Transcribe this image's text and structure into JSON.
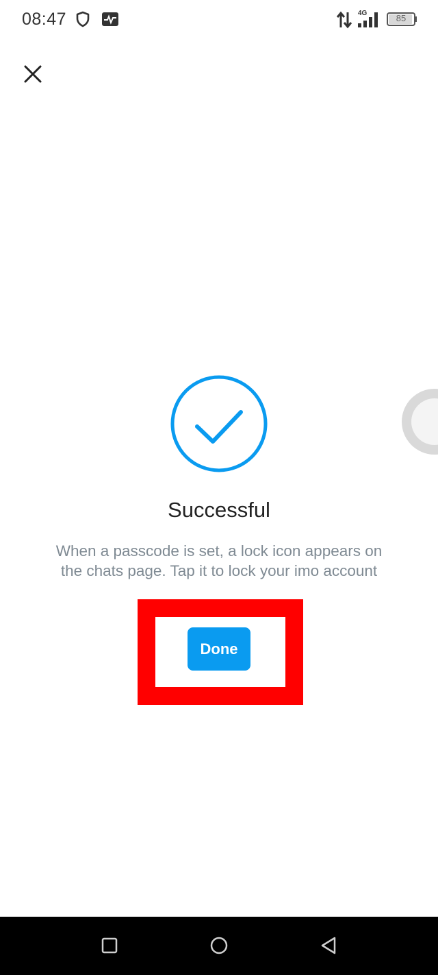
{
  "status_bar": {
    "time": "08:47",
    "battery_level": "85",
    "network_type": "4G",
    "icons": [
      "shield-icon",
      "activity-icon",
      "data-arrows-icon",
      "signal-icon",
      "battery-icon"
    ]
  },
  "header": {
    "close_icon": "close-icon"
  },
  "result": {
    "icon": "check-circle-icon",
    "title": "Successful",
    "description": "When a passcode is set, a lock icon appears on the chats page. Tap it to lock your imo account"
  },
  "actions": {
    "done_label": "Done"
  },
  "nav_bar": {
    "recent": "recent-apps-icon",
    "home": "home-icon",
    "back": "back-icon"
  },
  "colors": {
    "accent": "#0a9bf0",
    "highlight": "#ff0000",
    "title": "#222222",
    "description": "#7f8a93"
  }
}
